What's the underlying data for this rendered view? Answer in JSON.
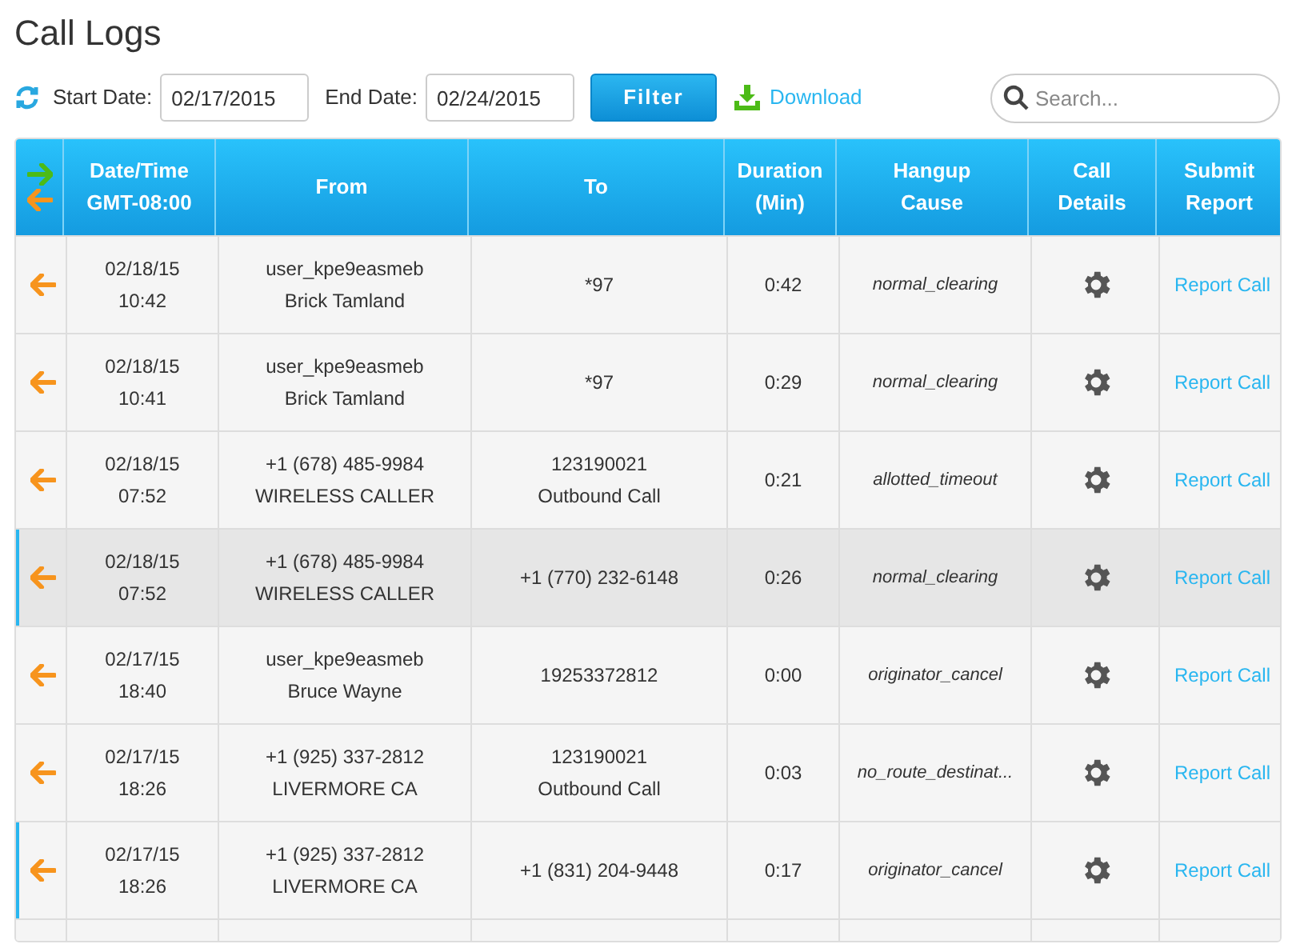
{
  "title": "Call Logs",
  "filters": {
    "start_label": "Start Date:",
    "start_value": "02/17/2015",
    "end_label": "End Date:",
    "end_value": "02/24/2015",
    "filter_button": "Filter",
    "download": "Download",
    "search_placeholder": "Search..."
  },
  "table": {
    "columns": [
      {
        "kind": "direction"
      },
      {
        "kind": "text",
        "lines": [
          "Date/Time",
          "GMT-08:00"
        ]
      },
      {
        "kind": "text",
        "lines": [
          "From"
        ]
      },
      {
        "kind": "text",
        "lines": [
          "To"
        ]
      },
      {
        "kind": "text",
        "lines": [
          "Duration",
          "(Min)"
        ]
      },
      {
        "kind": "text",
        "lines": [
          "Hangup",
          "Cause"
        ]
      },
      {
        "kind": "text",
        "lines": [
          "Call",
          "Details"
        ]
      },
      {
        "kind": "text",
        "lines": [
          "Submit",
          "Report"
        ]
      }
    ],
    "rows": [
      {
        "kind": "incoming",
        "flagged": false,
        "selected": false,
        "date": "02/18/15",
        "time": "10:42",
        "from": [
          "user_kpe9easmeb",
          "Brick Tamland"
        ],
        "to": [
          "*97"
        ],
        "duration": "0:42",
        "cause": "normal_clearing",
        "report": "Report Call"
      },
      {
        "kind": "incoming",
        "flagged": false,
        "selected": false,
        "date": "02/18/15",
        "time": "10:41",
        "from": [
          "user_kpe9easmeb",
          "Brick Tamland"
        ],
        "to": [
          "*97"
        ],
        "duration": "0:29",
        "cause": "normal_clearing",
        "report": "Report Call"
      },
      {
        "kind": "incoming",
        "flagged": false,
        "selected": false,
        "date": "02/18/15",
        "time": "07:52",
        "from": [
          "+1 (678) 485-9984",
          "WIRELESS CALLER"
        ],
        "to": [
          "123190021",
          "Outbound Call"
        ],
        "duration": "0:21",
        "cause": "allotted_timeout",
        "report": "Report Call"
      },
      {
        "kind": "incoming",
        "flagged": true,
        "selected": true,
        "date": "02/18/15",
        "time": "07:52",
        "from": [
          "+1 (678) 485-9984",
          "WIRELESS CALLER"
        ],
        "to": [
          "+1 (770) 232-6148"
        ],
        "duration": "0:26",
        "cause": "normal_clearing",
        "report": "Report Call"
      },
      {
        "kind": "incoming",
        "flagged": false,
        "selected": false,
        "date": "02/17/15",
        "time": "18:40",
        "from": [
          "user_kpe9easmeb",
          "Bruce Wayne"
        ],
        "to": [
          "19253372812"
        ],
        "duration": "0:00",
        "cause": "originator_cancel",
        "report": "Report Call"
      },
      {
        "kind": "incoming",
        "flagged": false,
        "selected": false,
        "date": "02/17/15",
        "time": "18:26",
        "from": [
          "+1 (925) 337-2812",
          "LIVERMORE CA"
        ],
        "to": [
          "123190021",
          "Outbound Call"
        ],
        "duration": "0:03",
        "cause": "no_route_destinat...",
        "report": "Report Call"
      },
      {
        "kind": "incoming",
        "flagged": true,
        "selected": false,
        "date": "02/17/15",
        "time": "18:26",
        "from": [
          "+1 (925) 337-2812",
          "LIVERMORE CA"
        ],
        "to": [
          "+1 (831) 204-9448"
        ],
        "duration": "0:17",
        "cause": "originator_cancel",
        "report": "Report Call"
      }
    ]
  }
}
